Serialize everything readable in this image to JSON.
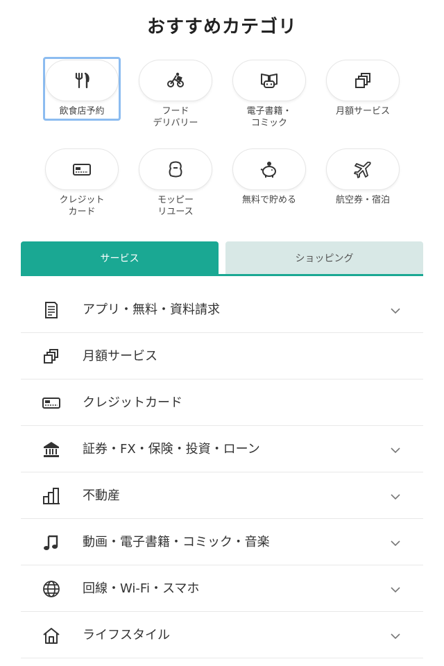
{
  "title": "おすすめカテゴリ",
  "categories": [
    {
      "label": "飲食店予約",
      "icon": "fork-knife-icon"
    },
    {
      "label": "フード\nデリバリー",
      "icon": "delivery-bike-icon"
    },
    {
      "label": "電子書籍・\nコミック",
      "icon": "book-gamepad-icon"
    },
    {
      "label": "月額サービス",
      "icon": "stacked-squares-icon"
    },
    {
      "label": "クレジット\nカード",
      "icon": "credit-card-icon"
    },
    {
      "label": "モッピー\nリユース",
      "icon": "reuse-bag-icon"
    },
    {
      "label": "無料で貯める",
      "icon": "piggy-bank-icon"
    },
    {
      "label": "航空券・宿泊",
      "icon": "airplane-icon"
    }
  ],
  "tabs": {
    "active": "サービス",
    "inactive": "ショッピング"
  },
  "menu": [
    {
      "label": "アプリ・無料・資料請求",
      "icon": "document-icon",
      "expandable": true
    },
    {
      "label": "月額サービス",
      "icon": "stacked-squares-icon",
      "expandable": false
    },
    {
      "label": "クレジットカード",
      "icon": "credit-card-icon",
      "expandable": false
    },
    {
      "label": "証券・FX・保険・投資・ローン",
      "icon": "bank-icon",
      "expandable": true
    },
    {
      "label": "不動産",
      "icon": "buildings-icon",
      "expandable": true
    },
    {
      "label": "動画・電子書籍・コミック・音楽",
      "icon": "music-note-icon",
      "expandable": true
    },
    {
      "label": "回線・Wi-Fi・スマホ",
      "icon": "globe-icon",
      "expandable": true
    },
    {
      "label": "ライフスタイル",
      "icon": "house-icon",
      "expandable": true
    }
  ],
  "colors": {
    "accent": "#1aa893",
    "tab_inactive_bg": "#d8e8e6",
    "selection_outline": "#8cbcf0"
  }
}
